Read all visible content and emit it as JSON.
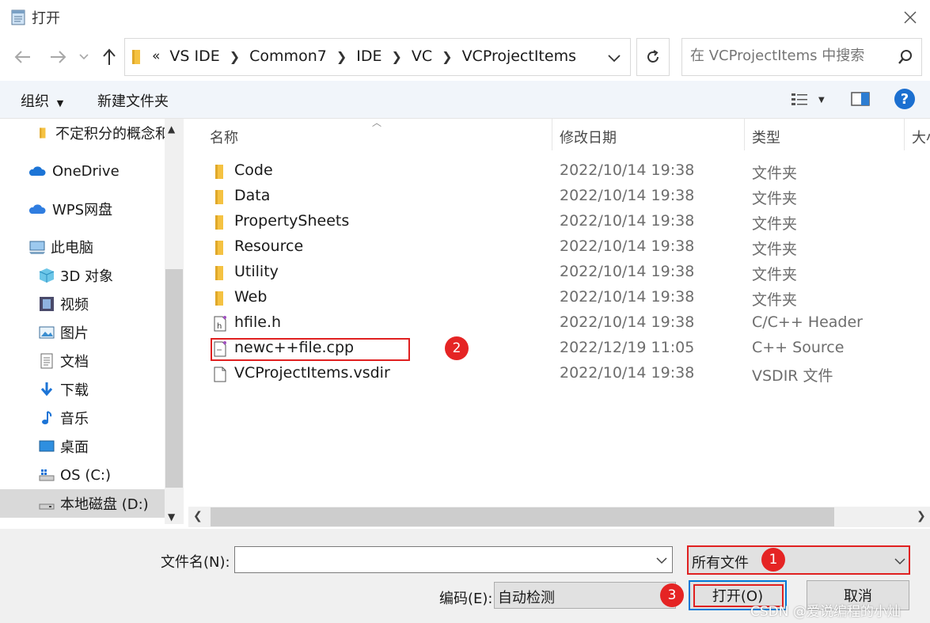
{
  "window": {
    "title": "打开"
  },
  "nav": {
    "breadcrumbs": [
      "«",
      "VS IDE",
      "Common7",
      "IDE",
      "VC",
      "VCProjectItems"
    ],
    "search_placeholder": "在 VCProjectItems 中搜索"
  },
  "toolbar": {
    "organize": "组织",
    "new_folder": "新建文件夹"
  },
  "sidebar": {
    "items": [
      {
        "label": "不定积分的概念和",
        "icon": "folder-icon"
      },
      {
        "label": "OneDrive",
        "icon": "cloud-icon"
      },
      {
        "label": "WPS网盘",
        "icon": "cloud-icon"
      },
      {
        "label": "此电脑",
        "icon": "computer-icon"
      },
      {
        "label": "3D 对象",
        "icon": "cube-icon"
      },
      {
        "label": "视频",
        "icon": "film-icon"
      },
      {
        "label": "图片",
        "icon": "picture-icon"
      },
      {
        "label": "文档",
        "icon": "document-icon"
      },
      {
        "label": "下载",
        "icon": "download-arrow-icon"
      },
      {
        "label": "音乐",
        "icon": "music-note-icon"
      },
      {
        "label": "桌面",
        "icon": "desktop-icon"
      },
      {
        "label": "OS (C:)",
        "icon": "drive-icon"
      },
      {
        "label": "本地磁盘 (D:)",
        "icon": "drive-icon"
      }
    ]
  },
  "columns": {
    "name": "名称",
    "date": "修改日期",
    "type": "类型",
    "size": "大小"
  },
  "files": [
    {
      "name": "Code",
      "date": "2022/10/14 19:38",
      "type": "文件夹",
      "icon": "folder-icon"
    },
    {
      "name": "Data",
      "date": "2022/10/14 19:38",
      "type": "文件夹",
      "icon": "folder-icon"
    },
    {
      "name": "PropertySheets",
      "date": "2022/10/14 19:38",
      "type": "文件夹",
      "icon": "folder-icon"
    },
    {
      "name": "Resource",
      "date": "2022/10/14 19:38",
      "type": "文件夹",
      "icon": "folder-icon"
    },
    {
      "name": "Utility",
      "date": "2022/10/14 19:38",
      "type": "文件夹",
      "icon": "folder-icon"
    },
    {
      "name": "Web",
      "date": "2022/10/14 19:38",
      "type": "文件夹",
      "icon": "folder-icon"
    },
    {
      "name": "hfile.h",
      "date": "2022/10/14 19:38",
      "type": "C/C++ Header",
      "icon": "header-file-icon"
    },
    {
      "name": "newc++file.cpp",
      "date": "2022/12/19 11:05",
      "type": "C++ Source",
      "icon": "cpp-file-icon"
    },
    {
      "name": "VCProjectItems.vsdir",
      "date": "2022/10/14 19:38",
      "type": "VSDIR 文件",
      "icon": "file-icon"
    }
  ],
  "bottom": {
    "filename_label": "文件名(N):",
    "filename_value": "",
    "filter_value": "所有文件",
    "encoding_label": "编码(E):",
    "encoding_value": "自动检测",
    "open_button": "打开(O)",
    "cancel_button": "取消"
  },
  "annotations": [
    "1",
    "2",
    "3"
  ],
  "watermark": "CSDN @爱说编程的小灿",
  "colors": {
    "highlight_red": "#e02020",
    "badge_red": "#e52424",
    "toolbar_bg": "#f1f5fa",
    "folder_yellow": "#f5c242"
  }
}
